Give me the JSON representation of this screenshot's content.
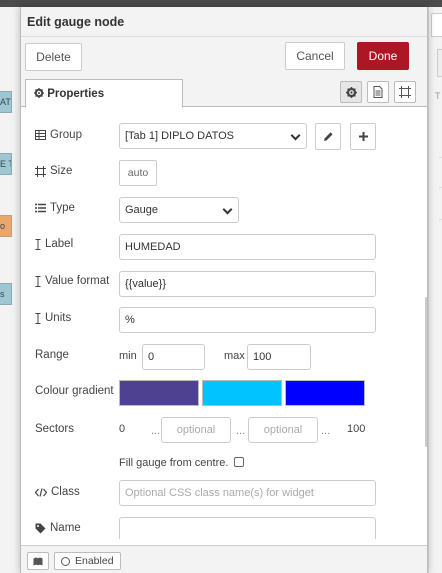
{
  "background": {
    "left_nodes": [
      "AT",
      "E T",
      "o",
      "s"
    ],
    "right_tab_label": "T"
  },
  "tray": {
    "title": "Edit gauge node",
    "toolbar": {
      "delete_label": "Delete",
      "cancel_label": "Cancel",
      "done_label": "Done"
    },
    "tabs": {
      "properties_label": "Properties"
    }
  },
  "form": {
    "group": {
      "label": "Group",
      "value": "[Tab 1] DIPLO DATOS"
    },
    "size": {
      "label": "Size",
      "value": "auto"
    },
    "type": {
      "label": "Type",
      "value": "Gauge"
    },
    "label_field": {
      "label": "Label",
      "value": "HUMEDAD"
    },
    "value_format": {
      "label": "Value format",
      "value": "{{value}}"
    },
    "units": {
      "label": "Units",
      "value": "%"
    },
    "range": {
      "label": "Range",
      "min_label": "min",
      "min_value": "0",
      "max_label": "max",
      "max_value": "100"
    },
    "colour_gradient": {
      "label": "Colour gradient",
      "colors": [
        "#4e4290",
        "#00c3ff",
        "#0000ff"
      ]
    },
    "sectors": {
      "label": "Sectors",
      "start": "0",
      "sep1": "...",
      "sep2": "...",
      "sep3": "...",
      "optional1_placeholder": "optional",
      "optional2_placeholder": "optional",
      "end": "100"
    },
    "fill_gauge": {
      "label": "Fill gauge from centre."
    },
    "class": {
      "label": "Class",
      "placeholder": "Optional CSS class name(s) for widget"
    },
    "name": {
      "label": "Name",
      "value": ""
    }
  },
  "footer": {
    "enabled_label": "Enabled"
  },
  "colors": {
    "accent": "#ad1625",
    "tray_bg": "#f3f3f3"
  }
}
